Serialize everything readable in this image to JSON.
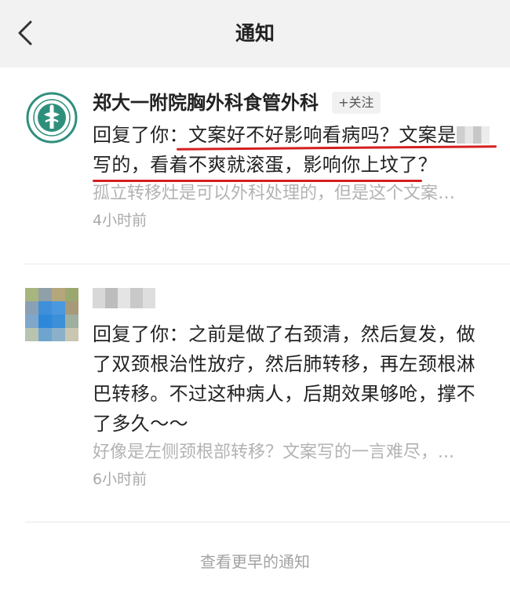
{
  "header": {
    "title": "通知",
    "back_icon": "chevron-left-icon"
  },
  "notifications": [
    {
      "sender": "郑大一附院胸外科食管外科",
      "follow_label": "+关注",
      "reply_prefix": "回复了你：",
      "reply_part1": "文案好不好影响看病吗？文案是",
      "reply_part2": "写的，看着不爽就滚蛋，影响你上坟了？",
      "quote": "孤立转移灶是可以外科处理的，但是这个文案…",
      "time": "4小时前",
      "avatar_icon": "hospital-logo-icon"
    },
    {
      "reply_prefix": "回复了你：",
      "reply_body": "之前是做了右颈清，然后复发，做了双颈根治性放疗，然后肺转移，再左颈根淋巴转移。不过这种病人，后期效果够呛，撑不了多久～～",
      "quote": "好像是左侧颈根部转移？文案写的一言难尽，...",
      "time": "6小时前",
      "avatar_icon": "blurred-avatar-icon"
    }
  ],
  "footer": {
    "more_label": "查看更早的通知"
  },
  "colors": {
    "header_bg": "#f2f2f2",
    "underline": "#d51f1f",
    "secondary_text": "#b3b3b3"
  }
}
